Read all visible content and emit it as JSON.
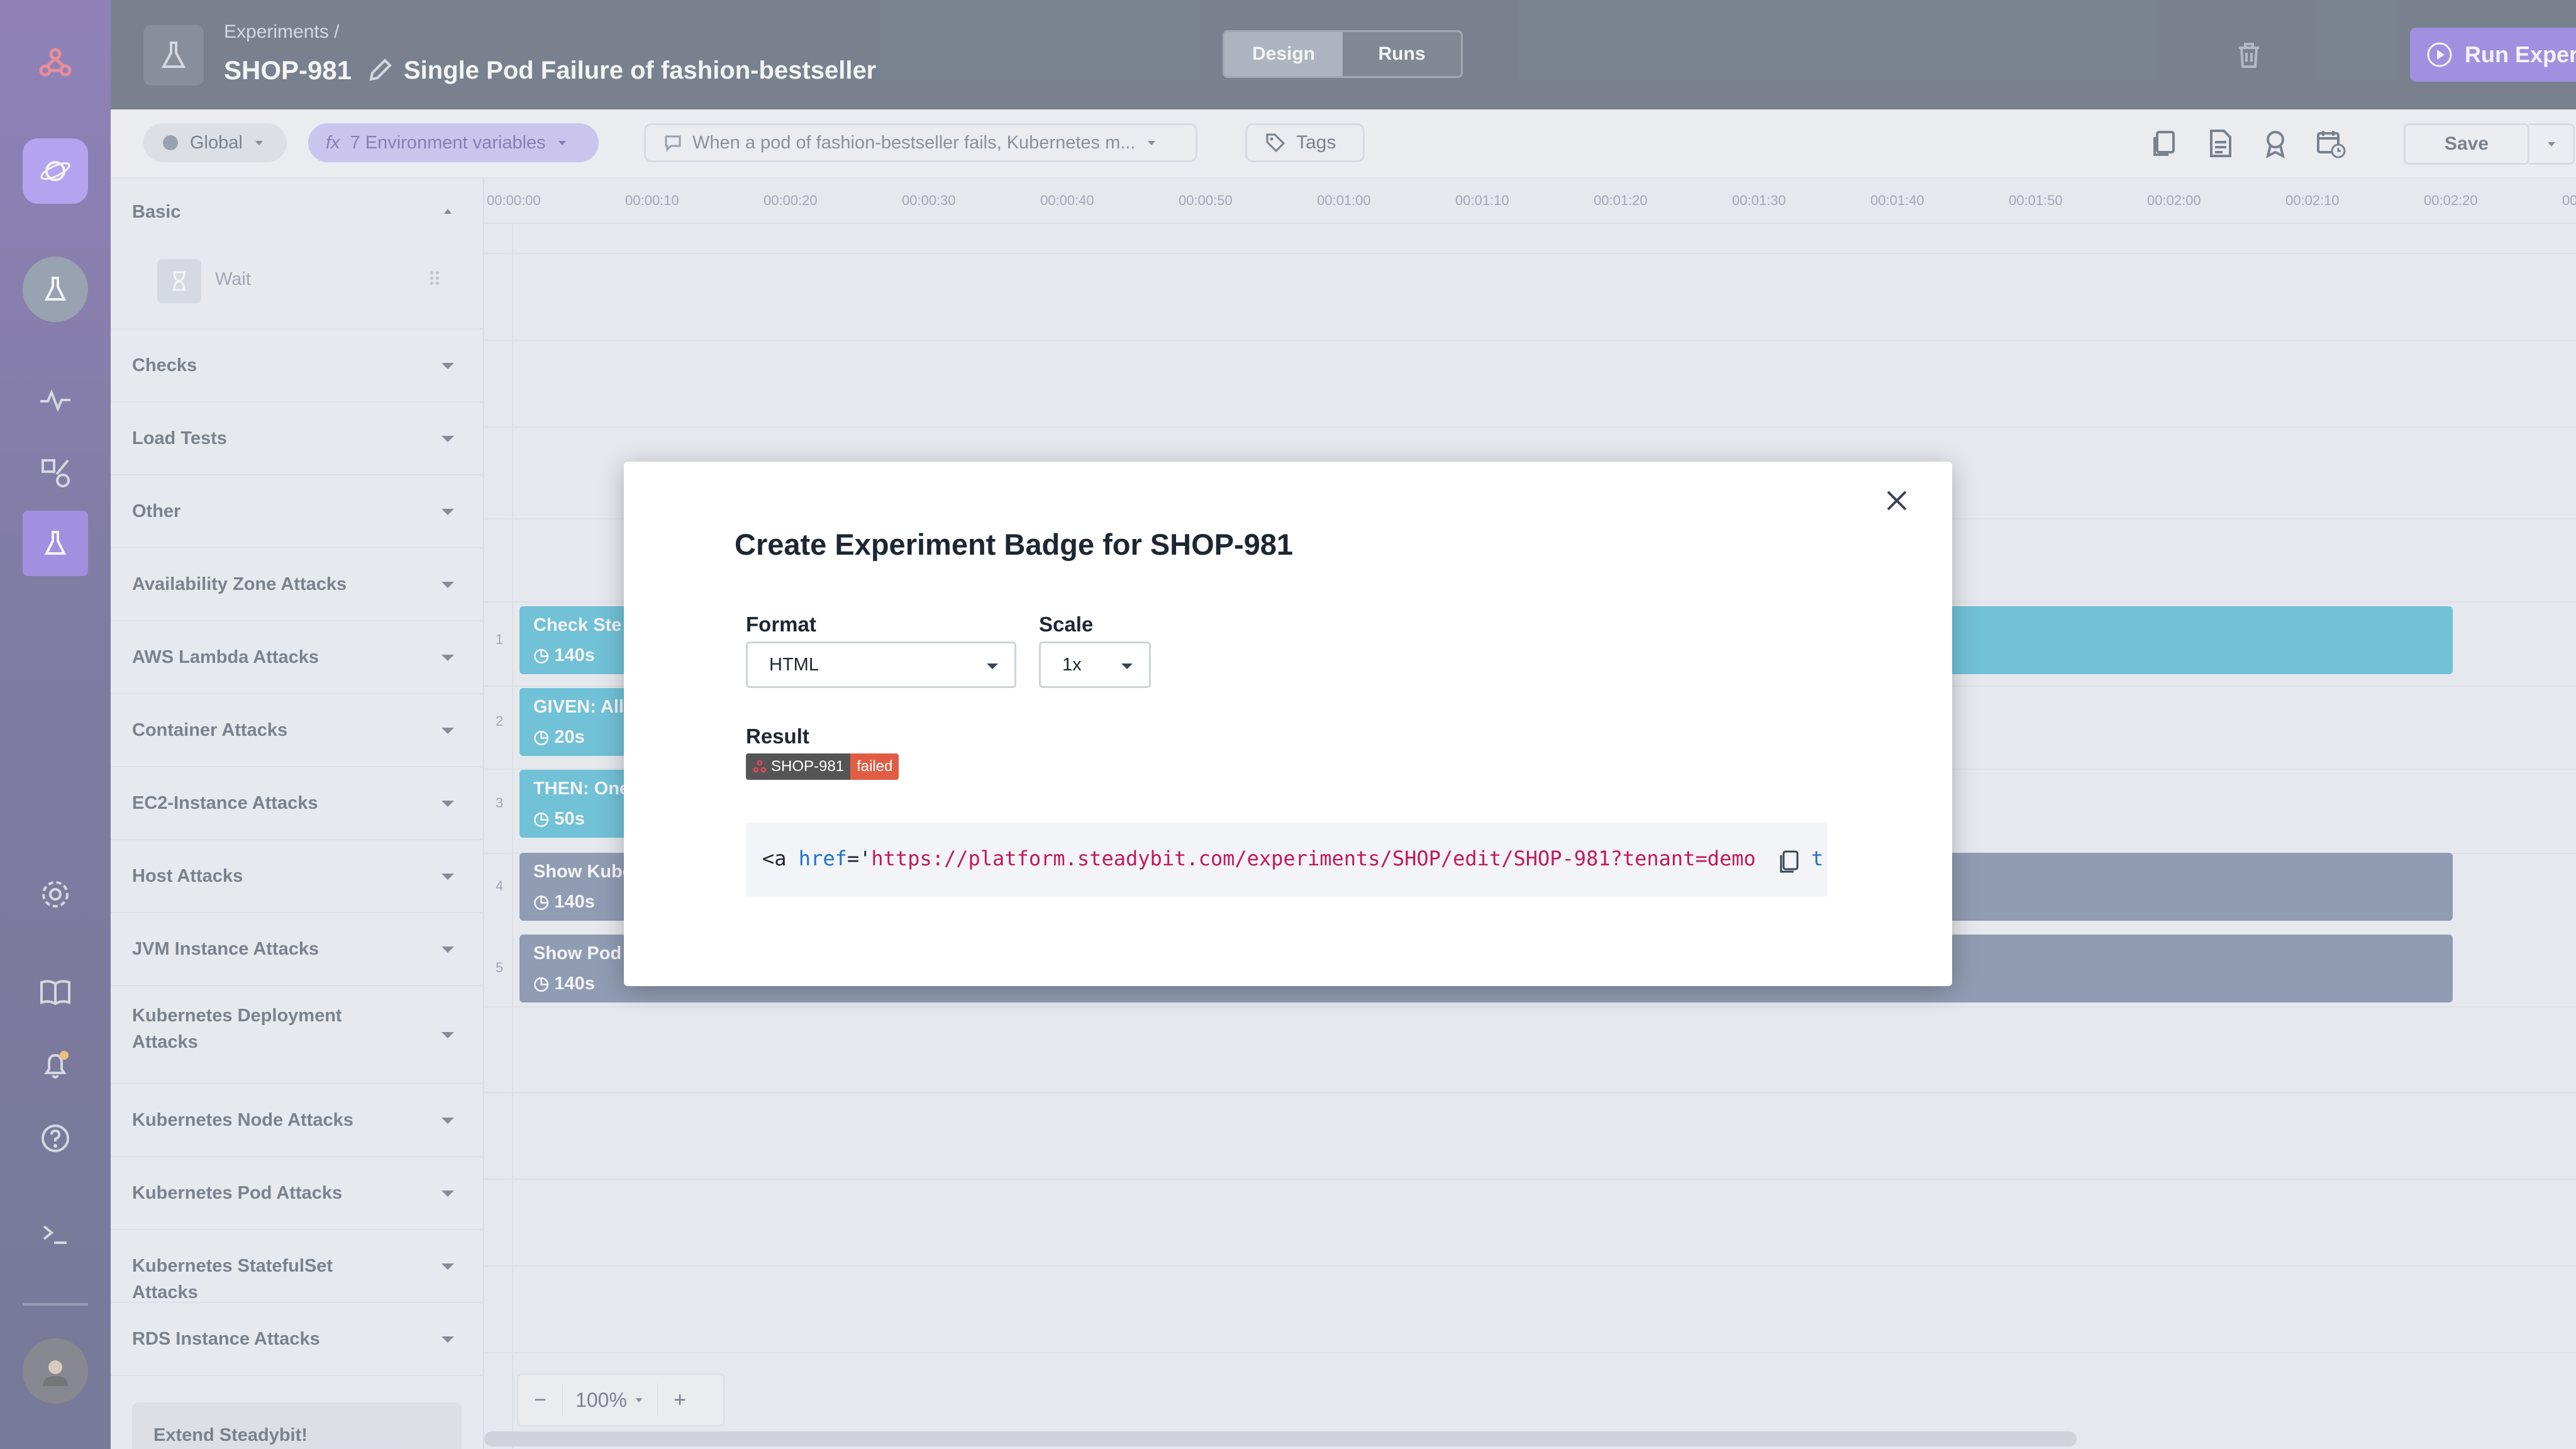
{
  "header": {
    "breadcrumb": "Experiments /",
    "experiment_key": "SHOP-981",
    "experiment_name": "Single Pod Failure of fashion-bestseller",
    "tabs": [
      {
        "label": "Design",
        "active": true
      },
      {
        "label": "Runs",
        "active": false
      }
    ],
    "run_button": "Run Experiment"
  },
  "toolbar": {
    "environment": "Global",
    "env_vars": "7 Environment variables",
    "env_vars_icon": "fx",
    "hypothesis": "When a pod of fashion-bestseller fails, Kubernetes m...",
    "tags": "Tags",
    "save": "Save"
  },
  "palette": {
    "basic": "Basic",
    "wait": "Wait",
    "categories": [
      "Checks",
      "Load Tests",
      "Other",
      "Availability Zone Attacks",
      "AWS Lambda Attacks",
      "Container Attacks",
      "EC2-Instance Attacks",
      "Host Attacks",
      "JVM Instance Attacks",
      "Kubernetes Deployment Attacks",
      "Kubernetes Node Attacks",
      "Kubernetes Pod Attacks",
      "Kubernetes StatefulSet Attacks",
      "RDS Instance Attacks"
    ],
    "extend": "Extend Steadybit!"
  },
  "timeline": {
    "ticks": [
      "00:00:00",
      "00:00:10",
      "00:00:20",
      "00:00:30",
      "00:00:40",
      "00:00:50",
      "00:01:00",
      "00:01:10",
      "00:01:20",
      "00:01:30",
      "00:01:40",
      "00:01:50",
      "00:02:00",
      "00:02:10",
      "00:02:20",
      "00"
    ],
    "rows": [
      {
        "num": "1",
        "title": "Check Ste",
        "duration": "140s"
      },
      {
        "num": "2",
        "title": "GIVEN: All",
        "duration": "20s"
      },
      {
        "num": "3",
        "title": "THEN: One",
        "duration": "50s"
      },
      {
        "num": "4",
        "title": "Show Kube",
        "duration": "140s"
      },
      {
        "num": "5",
        "title": "Show Pod",
        "duration": "140s"
      }
    ],
    "zoom": "100%"
  },
  "modal": {
    "title": "Create Experiment Badge for SHOP-981",
    "format_label": "Format",
    "format_value": "HTML",
    "scale_label": "Scale",
    "scale_value": "1x",
    "result_label": "Result",
    "badge_left": "SHOP-981",
    "badge_right": "failed",
    "code": {
      "open": "<a",
      "attr": "href",
      "eq": "='",
      "url": "https://platform.steadybit.com/experiments/SHOP/edit/SHOP-981?tenant=demo",
      "tail": "t"
    }
  },
  "colors": {
    "accent": "#6a48d8",
    "header_bg": "#222f42",
    "step_cyan": "#13a3c7",
    "step_blue": "#4a5f86",
    "badge_failed": "#e05d44"
  }
}
